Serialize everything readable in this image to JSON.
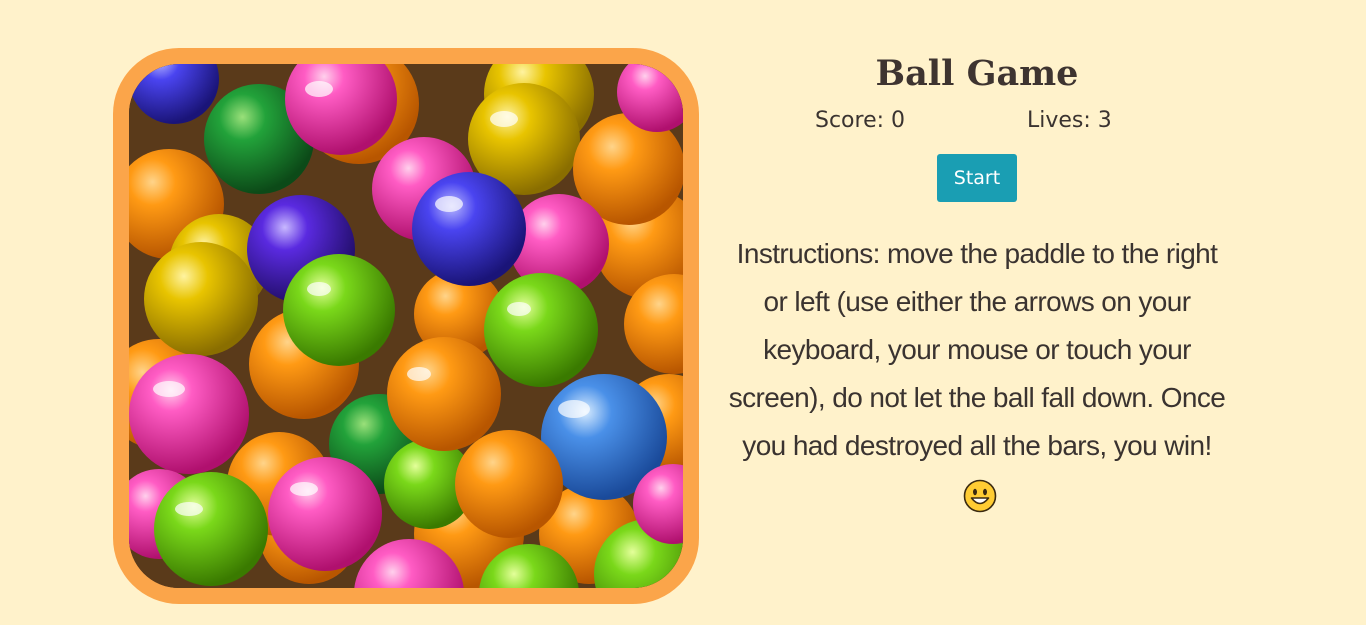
{
  "game": {
    "title": "Ball Game",
    "score_text": "Score: 0",
    "lives_text": "Lives: 3",
    "start_label": "Start",
    "instructions": "Instructions: move the paddle to the right or left (use either the arrows on your keyboard, your mouse or touch your screen), do not let the ball fall down. Once you had destroyed all the bars, you win!",
    "emoji_icon": "smiley-face-icon"
  },
  "colors": {
    "background": "#fff2cb",
    "frame": "#fba54a",
    "button": "#1a9eb3"
  }
}
